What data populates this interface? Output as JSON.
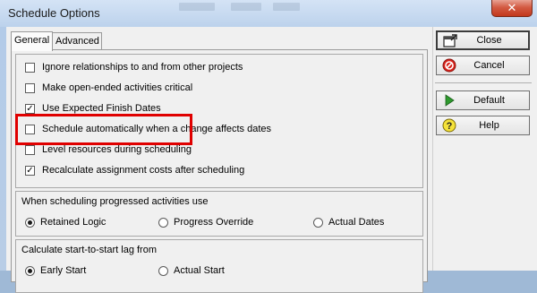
{
  "window": {
    "title": "Schedule Options",
    "close_glyph": "✕"
  },
  "tabs": [
    {
      "label": "General",
      "active": true
    },
    {
      "label": "Advanced",
      "active": false
    }
  ],
  "checkboxes": [
    {
      "label": "Ignore relationships to and from other projects",
      "checked": false
    },
    {
      "label": "Make open-ended activities critical",
      "checked": false
    },
    {
      "label": "Use Expected Finish Dates",
      "checked": true
    },
    {
      "label": "Schedule automatically when a change affects dates",
      "checked": false
    },
    {
      "label": "Level resources during scheduling",
      "checked": false
    },
    {
      "label": "Recalculate assignment costs after scheduling",
      "checked": true
    }
  ],
  "progressed_group": {
    "label": "When scheduling progressed activities use",
    "options": [
      {
        "label": "Retained Logic",
        "selected": true
      },
      {
        "label": "Progress Override",
        "selected": false
      },
      {
        "label": "Actual Dates",
        "selected": false
      }
    ]
  },
  "lag_group": {
    "label": "Calculate start-to-start lag from",
    "options": [
      {
        "label": "Early Start",
        "selected": true
      },
      {
        "label": "Actual Start",
        "selected": false
      }
    ]
  },
  "buttons": [
    {
      "label": "Close",
      "icon": "close-dialog-icon"
    },
    {
      "label": "Cancel",
      "icon": "cancel-icon"
    },
    {
      "label": "Default",
      "icon": "play-arrow-icon"
    },
    {
      "label": "Help",
      "icon": "help-icon"
    }
  ],
  "colors": {
    "highlight": "#e00000",
    "title_bar": "#bcd2ec",
    "close_button": "#c2381c"
  }
}
